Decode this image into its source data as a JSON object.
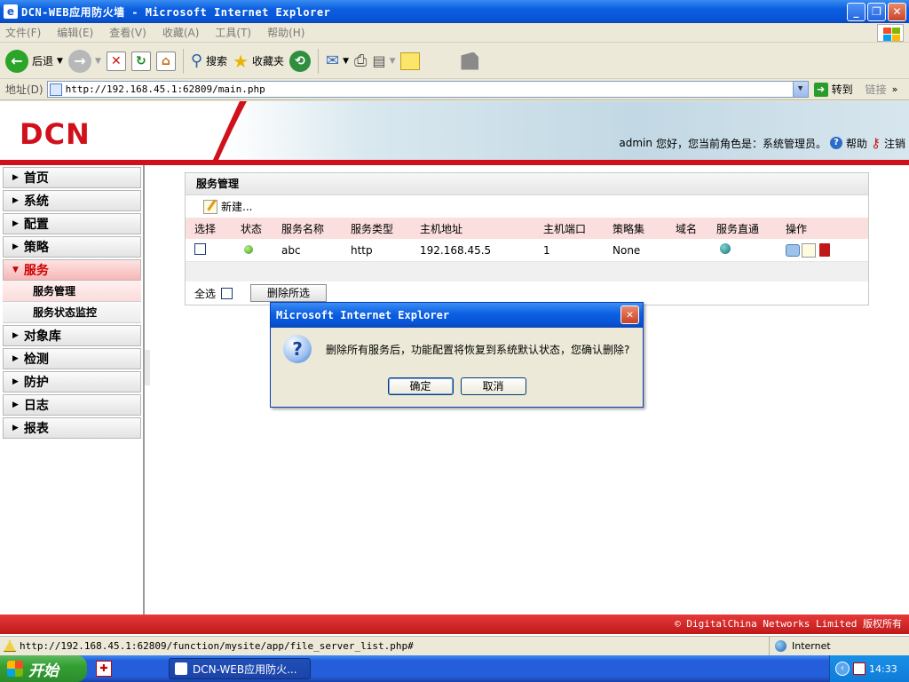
{
  "window": {
    "title": "DCN-WEB应用防火墙 - Microsoft Internet Explorer",
    "min_glyph": "_",
    "max_glyph": "❐",
    "close_glyph": "✕"
  },
  "menu": [
    "文件(F)",
    "编辑(E)",
    "查看(V)",
    "收藏(A)",
    "工具(T)",
    "帮助(H)"
  ],
  "toolbar": {
    "back": "后退",
    "search": "搜索",
    "favorites": "收藏夹"
  },
  "address": {
    "label": "地址(D)",
    "url": "http://192.168.45.1:62809/main.php",
    "go": "转到",
    "links": "链接"
  },
  "header": {
    "logo": "DCN",
    "user": "admin",
    "greeting": "您好，您当前角色是：系统管理员。",
    "help": "帮助",
    "logout": "注销"
  },
  "sidebar": {
    "items": [
      {
        "label": "首页"
      },
      {
        "label": "系统"
      },
      {
        "label": "配置"
      },
      {
        "label": "策略"
      },
      {
        "label": "服务"
      },
      {
        "label": "对象库"
      },
      {
        "label": "检测"
      },
      {
        "label": "防护"
      },
      {
        "label": "日志"
      },
      {
        "label": "报表"
      }
    ],
    "subitems": [
      "服务管理",
      "服务状态监控"
    ]
  },
  "panel": {
    "title": "服务管理",
    "new_label": "新建...",
    "columns": [
      "选择",
      "状态",
      "服务名称",
      "服务类型",
      "主机地址",
      "主机端口",
      "策略集",
      "域名",
      "服务直通",
      "操作"
    ],
    "rows": [
      {
        "name": "abc",
        "type": "http",
        "host": "192.168.45.5",
        "port": "1",
        "policy": "None",
        "domain": ""
      }
    ],
    "select_all": "全选",
    "delete_selected": "删除所选"
  },
  "copyright": "© DigitalChina Networks Limited 版权所有",
  "status": {
    "url": "http://192.168.45.1:62809/function/mysite/app/file_server_list.php#",
    "zone": "Internet"
  },
  "dialog": {
    "title": "Microsoft Internet Explorer",
    "message": "删除所有服务后，功能配置将恢复到系统默认状态，您确认删除?",
    "ok": "确定",
    "cancel": "取消"
  },
  "taskbar": {
    "start": "开始",
    "task": "DCN-WEB应用防火...",
    "time": "14:33"
  }
}
